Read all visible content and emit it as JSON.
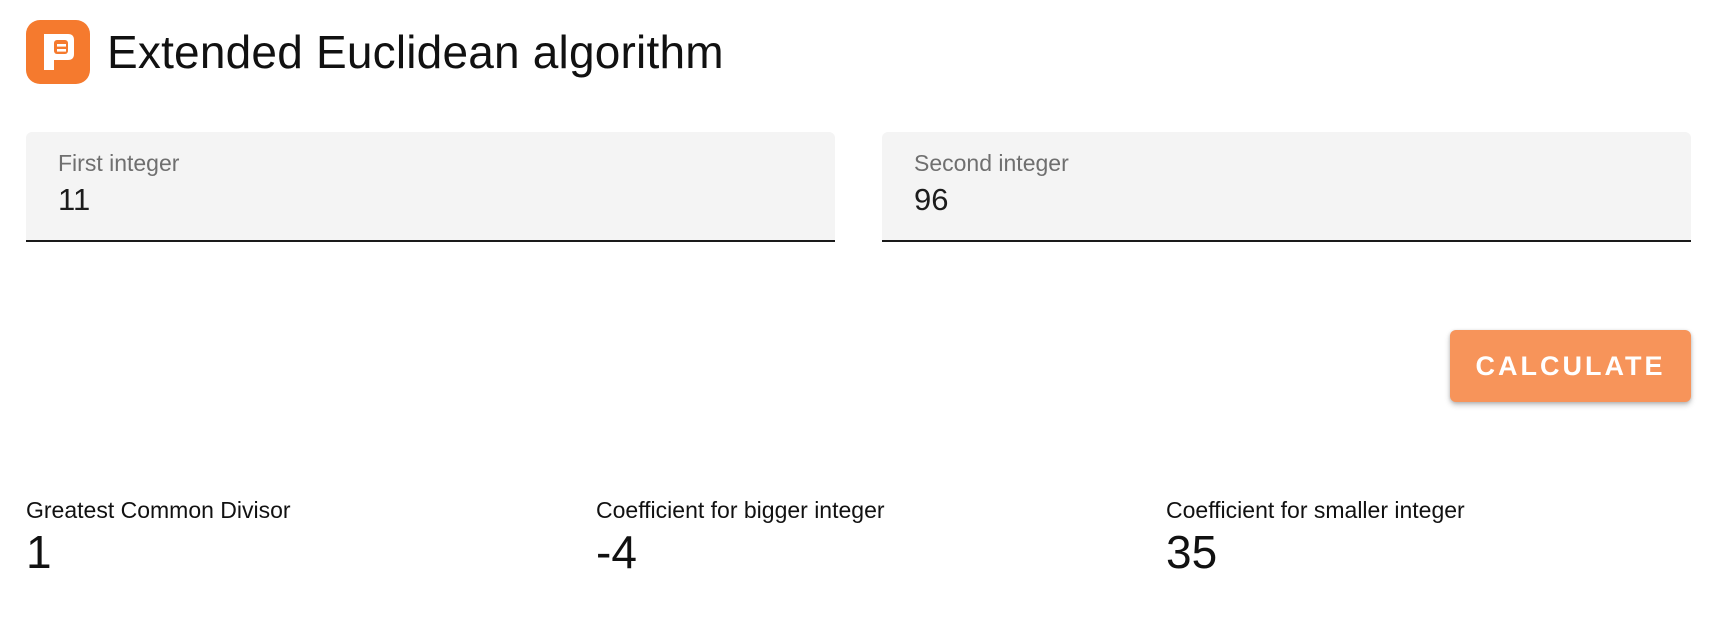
{
  "header": {
    "title": "Extended Euclidean algorithm",
    "logo_icon": "app-logo-icon",
    "accent_color": "#f57a2e"
  },
  "inputs": {
    "first": {
      "label": "First integer",
      "value": "11"
    },
    "second": {
      "label": "Second integer",
      "value": "96"
    }
  },
  "actions": {
    "calculate_label": "CALCULATE",
    "button_color": "#f7945a"
  },
  "results": {
    "gcd": {
      "label": "Greatest Common Divisor",
      "value": "1"
    },
    "bigger": {
      "label": "Coefficient for bigger integer",
      "value": "-4"
    },
    "smaller": {
      "label": "Coefficient for smaller integer",
      "value": "35"
    }
  }
}
